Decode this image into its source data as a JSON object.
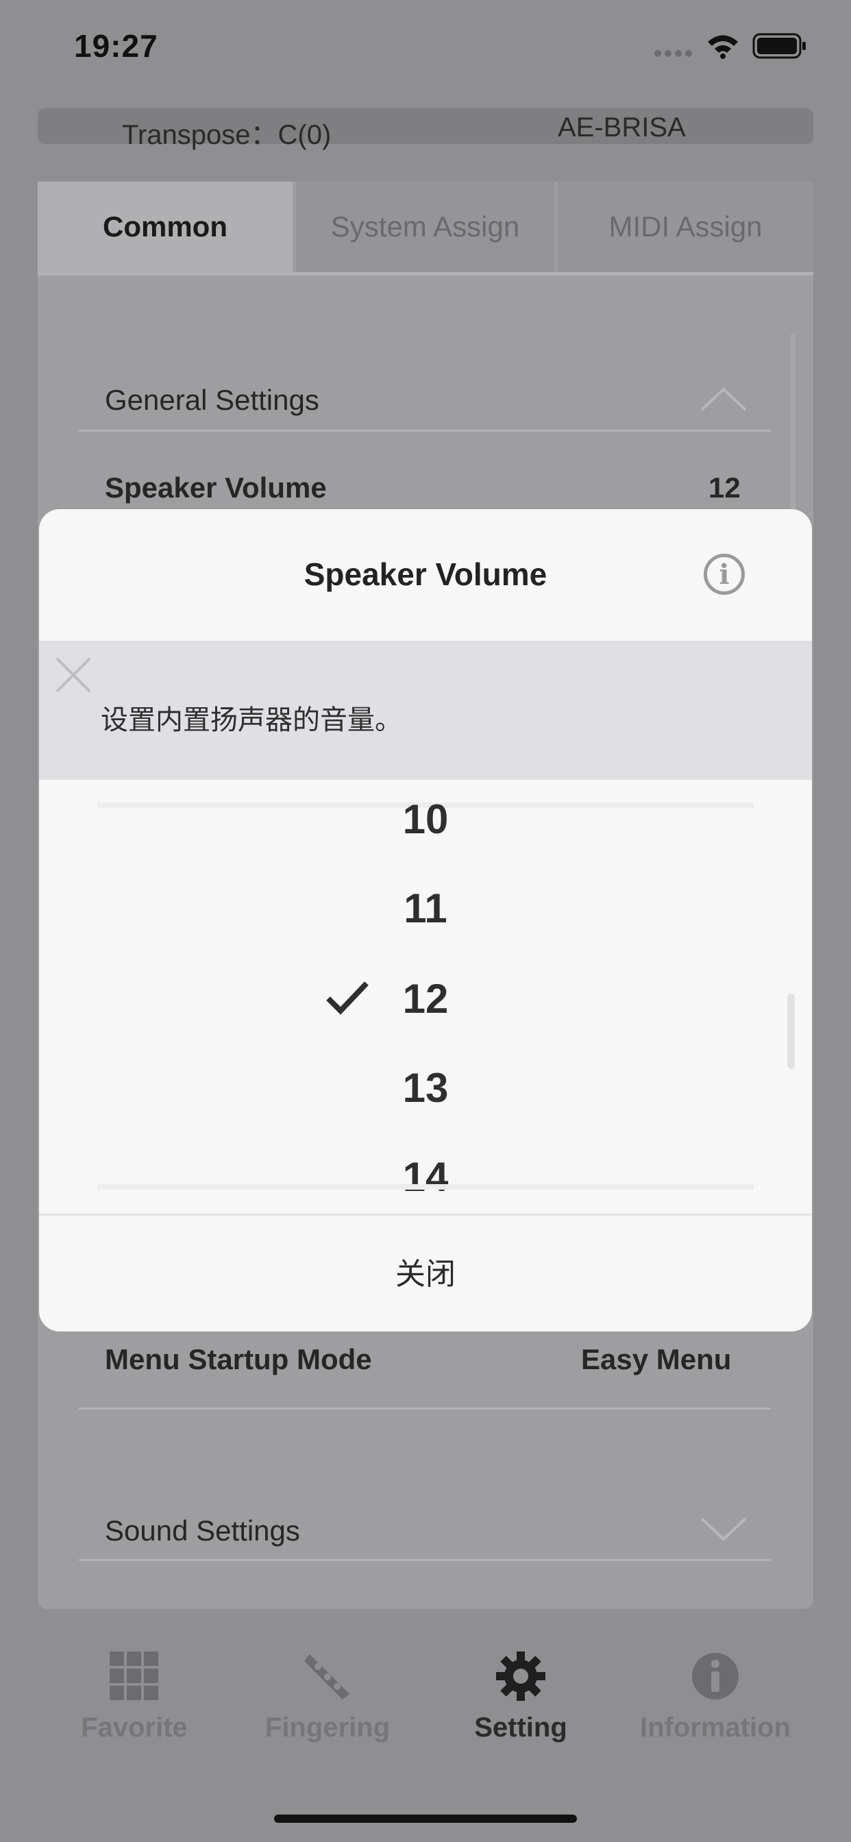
{
  "status": {
    "time": "19:27"
  },
  "header": {
    "transpose": "Transpose：C(0)",
    "device": "AE-BRISA"
  },
  "tabs": [
    {
      "label": "Common"
    },
    {
      "label": "System Assign"
    },
    {
      "label": "MIDI Assign"
    }
  ],
  "settings": {
    "general_section": "General Settings",
    "speaker_volume_label": "Speaker Volume",
    "speaker_volume_value": "12",
    "menu_startup_label": "Menu Startup Mode",
    "menu_startup_value": "Easy Menu",
    "sound_section": "Sound Settings"
  },
  "modal": {
    "title": "Speaker Volume",
    "description": "设置内置扬声器的音量。",
    "options": [
      "10",
      "11",
      "12",
      "13",
      "14"
    ],
    "selected": "12",
    "close_label": "关闭"
  },
  "tabbar": [
    {
      "label": "Favorite",
      "icon": "grid-icon"
    },
    {
      "label": "Fingering",
      "icon": "fingering-icon"
    },
    {
      "label": "Setting",
      "icon": "gear-icon"
    },
    {
      "label": "Information",
      "icon": "info-icon"
    }
  ]
}
